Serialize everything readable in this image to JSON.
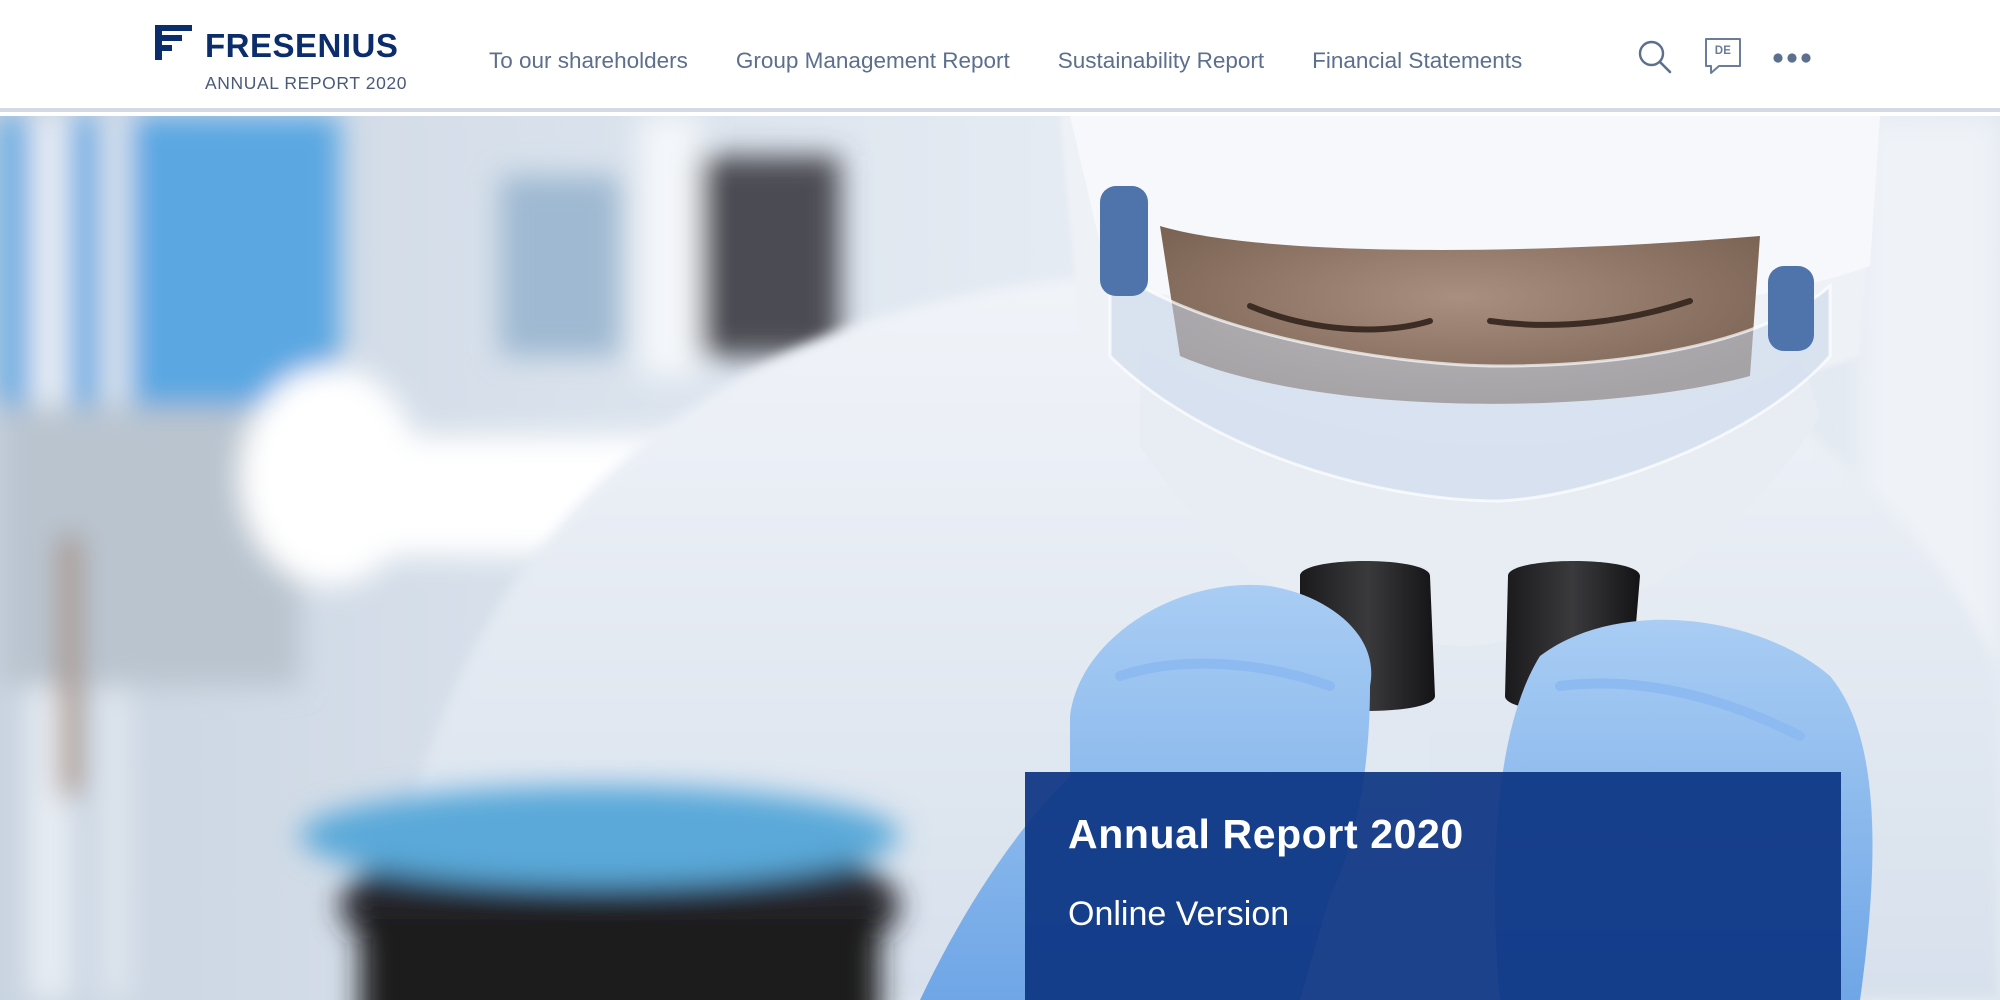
{
  "header": {
    "brand": {
      "name": "FRESENIUS",
      "subtitle": "ANNUAL REPORT 2020",
      "icon": "fresenius-logo-icon",
      "color": "#0c2d6b"
    },
    "nav": {
      "items": [
        {
          "label": "To our shareholders"
        },
        {
          "label": "Group Management Report"
        },
        {
          "label": "Sustainability Report"
        },
        {
          "label": "Financial Statements"
        }
      ]
    },
    "actions": {
      "search_icon": "search-icon",
      "language": {
        "icon": "speech-bubble-icon",
        "label": "DE"
      },
      "more_icon": "more-horizontal-icon"
    }
  },
  "hero": {
    "image": "Lab technician in protective hood, goggles and blue gloves examining two vials",
    "title": "Annual Report 2020",
    "subtitle": "Online Version",
    "card_color": "#0c3482"
  }
}
